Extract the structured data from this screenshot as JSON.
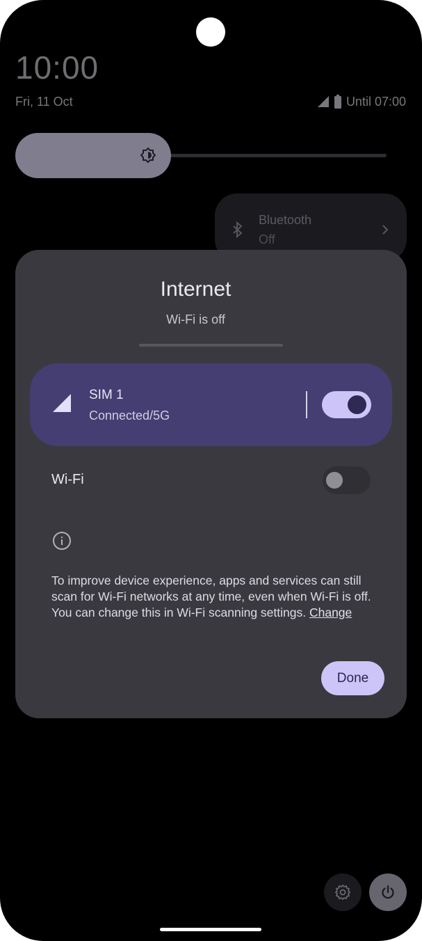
{
  "status_bar": {
    "time": "10:00",
    "date": "Fri, 11 Oct",
    "battery_text": "Until 07:00"
  },
  "quick_settings": {
    "brightness_level": 0.42,
    "bluetooth": {
      "title": "Bluetooth",
      "status": "Off"
    }
  },
  "internet_dialog": {
    "title": "Internet",
    "subtitle": "Wi-Fi is off",
    "sim": {
      "name": "SIM 1",
      "status": "Connected/5G",
      "enabled": true
    },
    "wifi": {
      "label": "Wi-Fi",
      "enabled": false
    },
    "info_text": "To improve device experience, apps and services can still scan for Wi-Fi networks at any time, even when Wi-Fi is off. You can change this in Wi-Fi scanning settings.",
    "info_link": "Change",
    "done_label": "Done"
  },
  "colors": {
    "dialog_bg": "#3a393f",
    "sim_card_bg": "#443e72",
    "accent": "#cdc4f7"
  },
  "icons": {
    "bluetooth": "bluetooth-icon",
    "signal": "signal-icon",
    "battery": "battery-icon",
    "brightness": "brightness-icon",
    "info": "info-icon",
    "settings": "gear-icon",
    "power": "power-icon"
  }
}
